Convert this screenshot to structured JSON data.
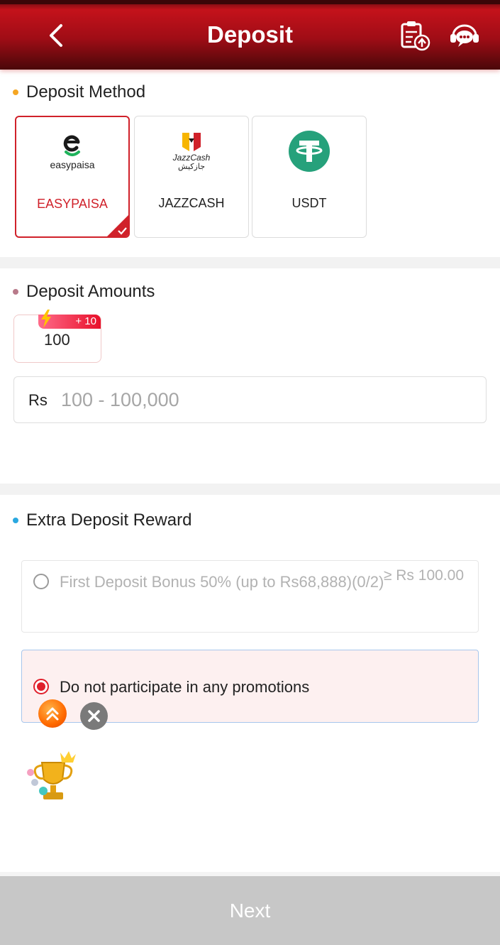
{
  "header": {
    "title": "Deposit",
    "back_icon": "chevron-left-icon",
    "records_icon": "clipboard-upload-icon",
    "support_icon": "support-chat-icon",
    "gradient_colors": [
      "#c4121b",
      "#4a0709"
    ]
  },
  "deposit_method": {
    "title": "Deposit Method",
    "dot_color": "#f5a623",
    "methods": [
      {
        "label": "EASYPAISA",
        "logo_text": "easypaisa",
        "selected": true
      },
      {
        "label": "JAZZCASH",
        "logo_text": "JazzCash",
        "logo_subtext": "جازکیش",
        "selected": false
      },
      {
        "label": "USDT",
        "logo_icon": "tether-icon",
        "selected": false
      }
    ]
  },
  "deposit_amounts": {
    "title": "Deposit Amounts",
    "dot_color": "#b87a8a",
    "chips": [
      {
        "value": "100",
        "bonus": "+ 10"
      }
    ],
    "currency": "Rs",
    "input_placeholder": "100 - 100,000"
  },
  "extra_reward": {
    "title": "Extra Deposit Reward",
    "dot_color": "#2aa8e0",
    "options": [
      {
        "text": "First Deposit Bonus 50% (up to Rs68,888)(0/2)",
        "amount": "≥ Rs 100.00",
        "selected": false
      },
      {
        "text": "Do not participate in any promotions",
        "selected": true
      }
    ]
  },
  "footer": {
    "next_label": "Next"
  },
  "accent_color": "#d0212a"
}
